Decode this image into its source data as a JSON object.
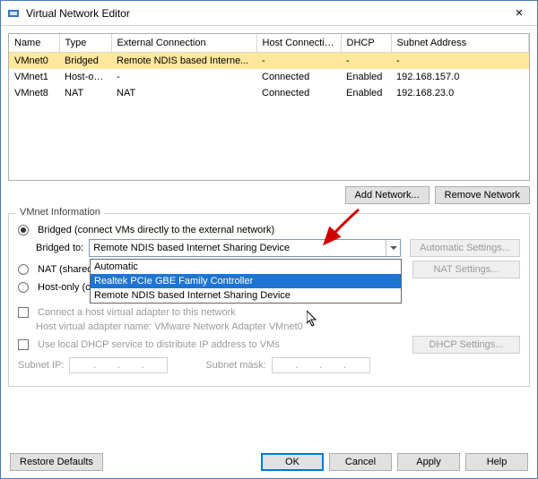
{
  "window": {
    "title": "Virtual Network Editor",
    "close_glyph": "✕"
  },
  "table": {
    "cols": [
      "Name",
      "Type",
      "External Connection",
      "Host Connection",
      "DHCP",
      "Subnet Address"
    ],
    "rows": [
      {
        "name": "VMnet0",
        "type": "Bridged",
        "ext": "Remote NDIS based Interne...",
        "host": "-",
        "dhcp": "-",
        "subnet": "-",
        "selected": true
      },
      {
        "name": "VMnet1",
        "type": "Host-only",
        "ext": "-",
        "host": "Connected",
        "dhcp": "Enabled",
        "subnet": "192.168.157.0"
      },
      {
        "name": "VMnet8",
        "type": "NAT",
        "ext": "NAT",
        "host": "Connected",
        "dhcp": "Enabled",
        "subnet": "192.168.23.0"
      }
    ]
  },
  "buttons": {
    "add_network": "Add Network...",
    "remove_network": "Remove Network",
    "auto_settings": "Automatic Settings...",
    "nat_settings": "NAT Settings...",
    "dhcp_settings": "DHCP Settings...",
    "restore": "Restore Defaults",
    "ok": "OK",
    "cancel": "Cancel",
    "apply": "Apply",
    "help": "Help"
  },
  "info": {
    "legend": "VMnet Information",
    "bridged_label": "Bridged (connect VMs directly to the external network)",
    "bridged_to": "Bridged to:",
    "combo_value": "Remote NDIS based Internet Sharing Device",
    "options": [
      "Automatic",
      "Realtek PCIe GBE Family Controller",
      "Remote NDIS based Internet Sharing Device"
    ],
    "highlight_index": 1,
    "nat_label": "NAT (shared host's IP address with VMs)",
    "hostonly_label": "Host-only (connect VMs internally in a private network)",
    "connect_host": "Connect a host virtual adapter to this network",
    "host_adapter_name": "Host virtual adapter name: VMware Network Adapter VMnet0",
    "use_dhcp": "Use local DHCP service to distribute IP address to VMs",
    "subnet_ip_label": "Subnet IP:",
    "subnet_mask_label": "Subnet mask:"
  }
}
